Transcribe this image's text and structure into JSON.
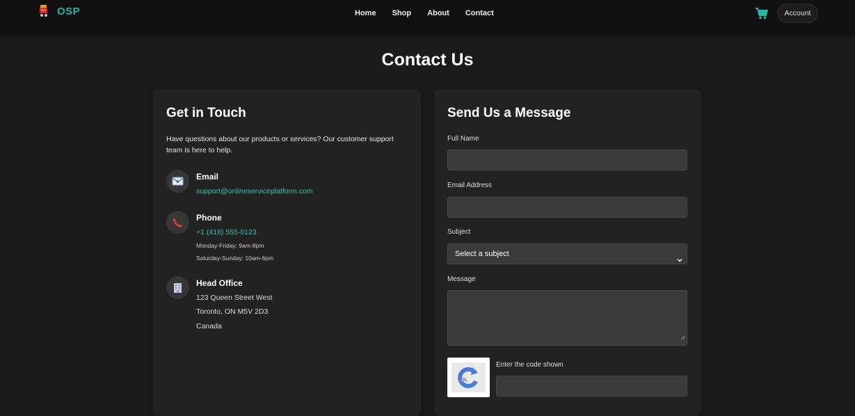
{
  "brand": {
    "name": "OSP",
    "accent": "#24b7a2"
  },
  "nav": {
    "links": [
      "Home",
      "Shop",
      "About",
      "Contact"
    ]
  },
  "header": {
    "cart_icon": "cart-icon",
    "account_label": "Account"
  },
  "page": {
    "title": "Contact Us"
  },
  "contact_info": {
    "heading": "Get in Touch",
    "intro": "Have questions about our products or services? Our customer support team is here to help.",
    "email": {
      "icon": "envelope-icon",
      "title": "Email",
      "value": "support@onlineserviceplatform.com"
    },
    "phone": {
      "icon": "phone-icon",
      "title": "Phone",
      "value": "+1 (416) 555-0123",
      "hours_weekday": "Monday-Friday: 9am-8pm",
      "hours_weekend": "Saturday-Sunday: 10am-6pm"
    },
    "office": {
      "icon": "building-icon",
      "title": "Head Office",
      "line1": "123 Queen Street West",
      "line2": "Toronto, ON M5V 2D3",
      "line3": "Canada"
    }
  },
  "form": {
    "heading": "Send Us a Message",
    "full_name_label": "Full Name",
    "full_name_value": "",
    "email_label": "Email Address",
    "email_value": "",
    "subject_label": "Subject",
    "subject_selected": "Select a subject",
    "message_label": "Message",
    "message_value": "",
    "captcha_label": "Enter the code shown",
    "captcha_icon": "recaptcha-icon",
    "captcha_value": ""
  }
}
